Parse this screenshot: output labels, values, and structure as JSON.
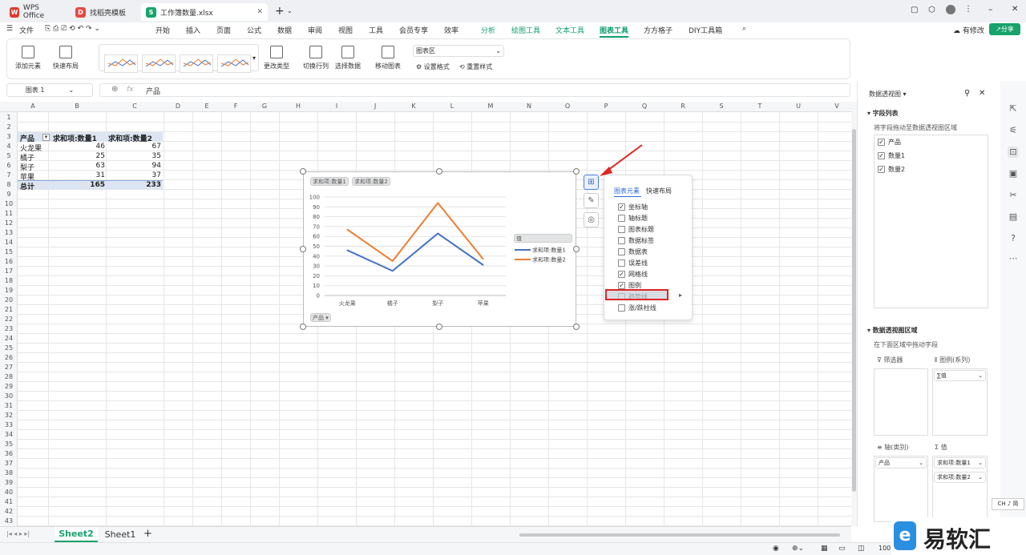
{
  "titlebar": {
    "tabs": [
      {
        "label": "WPS Office",
        "logo": "W",
        "color": "#e03b2f"
      },
      {
        "label": "找稻壳模板",
        "logo": "D",
        "color": "#e24a44"
      },
      {
        "label": "工作簿数量.xlsx",
        "logo": "S",
        "color": "#17a36b"
      }
    ],
    "new_tab": "+"
  },
  "menubar": {
    "file": "文件",
    "items": [
      "开始",
      "插入",
      "页面",
      "公式",
      "数据",
      "审阅",
      "视图",
      "工具",
      "会员专享",
      "效率"
    ],
    "context_items": [
      "分析",
      "绘图工具",
      "文本工具"
    ],
    "active_item": "图表工具",
    "extra_items": [
      "方方格子",
      "DIY工具箱"
    ],
    "edit_label": "有修改",
    "share_label": "分享"
  },
  "ribbon": {
    "add_element": "添加元素",
    "quick_layout": "快速布局",
    "change_type": "更改类型",
    "switch_row_col": "切换行列",
    "select_data": "选择数据",
    "move_chart": "移动图表",
    "chart_area_select": "图表区",
    "set_format": "设置格式",
    "reset_style": "重置样式"
  },
  "formula_bar": {
    "name_box": "图表 1",
    "fx": "fx",
    "content": "产品"
  },
  "grid": {
    "columns": [
      "A",
      "B",
      "C",
      "D",
      "E",
      "F",
      "G",
      "H",
      "I",
      "J",
      "K",
      "L",
      "M",
      "N",
      "O",
      "P",
      "Q",
      "R",
      "S",
      "T",
      "U",
      "V"
    ],
    "rows": [
      "1",
      "2",
      "3",
      "4",
      "5",
      "6",
      "7",
      "8",
      "9",
      "10",
      "11",
      "12",
      "13",
      "14",
      "15",
      "16",
      "17",
      "18",
      "19",
      "20",
      "21",
      "22",
      "23",
      "24",
      "25",
      "26",
      "27",
      "28",
      "29",
      "30",
      "31",
      "32",
      "33",
      "34",
      "35",
      "36",
      "37",
      "38",
      "39",
      "40",
      "41",
      "42",
      "43"
    ]
  },
  "pivot": {
    "headers": [
      "产品",
      "求和项:数量1",
      "求和项:数量2"
    ],
    "rows": [
      {
        "name": "火龙果",
        "q1": "46",
        "q2": "67"
      },
      {
        "name": "橘子",
        "q1": "25",
        "q2": "35"
      },
      {
        "name": "梨子",
        "q1": "63",
        "q2": "94"
      },
      {
        "name": "苹果",
        "q1": "31",
        "q2": "37"
      }
    ],
    "total": {
      "name": "总计",
      "q1": "165",
      "q2": "233"
    }
  },
  "chart_data": {
    "type": "line",
    "categories": [
      "火龙果",
      "橘子",
      "梨子",
      "苹果"
    ],
    "series": [
      {
        "name": "求和项:数量1",
        "values": [
          46,
          25,
          63,
          31
        ],
        "color": "#4472c4"
      },
      {
        "name": "求和项:数量2",
        "values": [
          67,
          35,
          94,
          37
        ],
        "color": "#ed7d31"
      }
    ],
    "ylim": [
      0,
      100
    ],
    "yticks": [
      "100",
      "90",
      "80",
      "70",
      "60",
      "50",
      "40",
      "30",
      "20",
      "10",
      "0"
    ],
    "grid": true,
    "legend_title": "值",
    "legend_position": "right",
    "field_buttons": [
      "求和项:数量1",
      "求和项:数量2"
    ],
    "axis_field_button": "产品"
  },
  "popup": {
    "tabs": [
      "图表元素",
      "快速布局"
    ],
    "items": [
      {
        "label": "坐标轴",
        "checked": true
      },
      {
        "label": "轴标题",
        "checked": false
      },
      {
        "label": "图表标题",
        "checked": false
      },
      {
        "label": "数据标签",
        "checked": false
      },
      {
        "label": "数据表",
        "checked": false
      },
      {
        "label": "误差线",
        "checked": false
      },
      {
        "label": "网格线",
        "checked": true
      },
      {
        "label": "图例",
        "checked": true
      },
      {
        "label": "趋势线",
        "checked": false
      },
      {
        "label": "涨/跌柱线",
        "checked": false
      }
    ],
    "arrow": "▸"
  },
  "panel": {
    "title": "数据透视图",
    "field_list": "字段列表",
    "field_hint": "将字段拖动至数据透视图区域",
    "fields": [
      "产品",
      "数量1",
      "数量2"
    ],
    "area_title": "数据透视图区域",
    "area_hint": "在下面区域中拖动字段",
    "filter": "筛选器",
    "legend": "图例(系列)",
    "legend_value": "∑值",
    "axis": "轴(类别)",
    "values": "值",
    "axis_value": "产品",
    "value_items": [
      "求和项:数量1",
      "求和项:数量2"
    ]
  },
  "sheets": {
    "tabs": [
      "Sheet2",
      "Sheet1"
    ],
    "add": "+"
  },
  "status": {
    "zoom": "100",
    "ime": "CH ♪ 简"
  },
  "watermark": "易软汇"
}
